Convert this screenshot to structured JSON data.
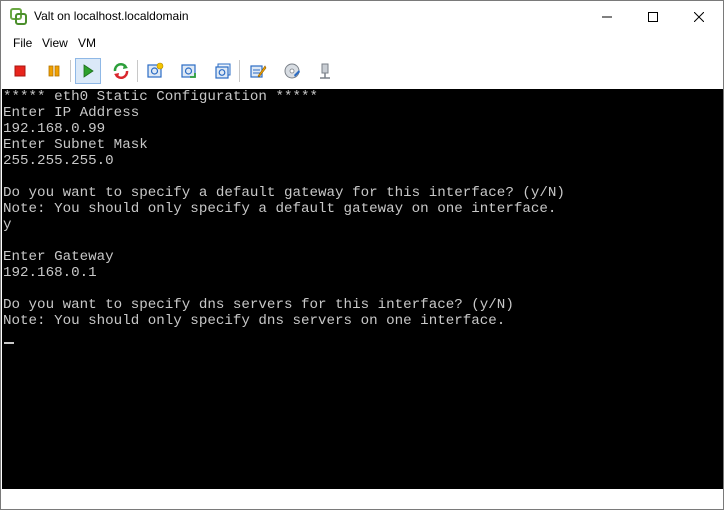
{
  "window": {
    "title": "Valt on localhost.localdomain"
  },
  "menu": {
    "file": "File",
    "view": "View",
    "vm": "VM"
  },
  "toolbar": {
    "icons": [
      "stop-icon",
      "pause-icon",
      "play-icon",
      "reset-icon",
      "snapshot-icon",
      "revert-snapshot-icon",
      "manage-snapshots-icon",
      "edit-settings-icon",
      "cd-dvd-icon",
      "network-icon"
    ],
    "colors": {
      "stop": "#e8241c",
      "pause": "#f0a000",
      "play": "#2ca02c",
      "reset_green": "#2c9f3a",
      "reset_red": "#d9262c",
      "blue": "#2b6cc4"
    }
  },
  "console": {
    "lines": [
      "***** eth0 Static Configuration *****",
      "Enter IP Address",
      "192.168.0.99",
      "Enter Subnet Mask",
      "255.255.255.0",
      "",
      "Do you want to specify a default gateway for this interface? (y/N)",
      "Note: You should only specify a default gateway on one interface.",
      "y",
      "",
      "Enter Gateway",
      "192.168.0.1",
      "",
      "Do you want to specify dns servers for this interface? (y/N)",
      "Note: You should only specify dns servers on one interface.",
      ""
    ]
  }
}
